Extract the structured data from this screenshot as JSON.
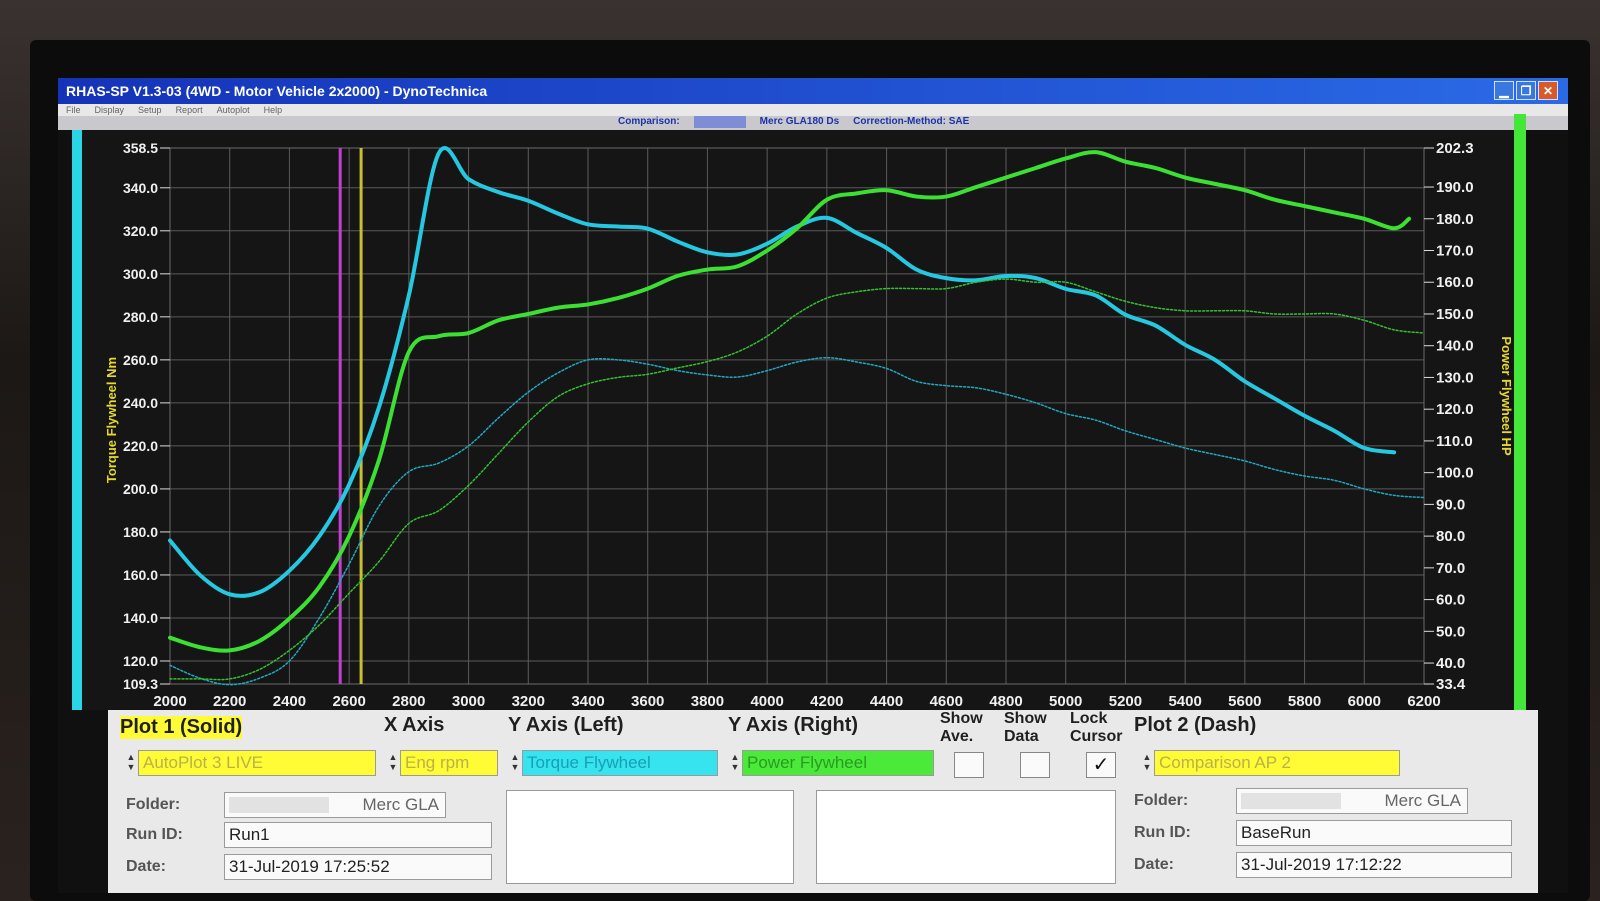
{
  "window": {
    "title": "RHAS-SP V1.3-03  (4WD - Motor Vehicle 2x2000) - DynoTechnica",
    "menu": [
      "File",
      "Display",
      "Setup",
      "Report",
      "Autoplot",
      "Help"
    ],
    "info_comparison": "Comparison:",
    "info_run": "Merc GLA180 Ds",
    "info_correction": "Correction-Method: SAE"
  },
  "chart_data": {
    "type": "line",
    "xlim": [
      2000,
      6200
    ],
    "x_ticks": [
      "2000",
      "2200",
      "2400",
      "2600",
      "2800",
      "3000",
      "3200",
      "3400",
      "3600",
      "3800",
      "4000",
      "4200",
      "4400",
      "4600",
      "4800",
      "5000",
      "5200",
      "5400",
      "5600",
      "5800",
      "6000",
      "6200"
    ],
    "ylabel_left": "Torque Flywheel Nm",
    "ylim_left": [
      109.3,
      358.5
    ],
    "y_ticks_left": [
      "358.5",
      "340.0",
      "320.0",
      "300.0",
      "280.0",
      "260.0",
      "240.0",
      "220.0",
      "200.0",
      "180.0",
      "160.0",
      "140.0",
      "120.0",
      "109.3"
    ],
    "ylabel_right": "Power Flywheel HP",
    "ylim_right": [
      33.4,
      202.3
    ],
    "y_ticks_right": [
      "202.3",
      "190.0",
      "180.0",
      "170.0",
      "160.0",
      "150.0",
      "140.0",
      "130.0",
      "120.0",
      "110.0",
      "100.0",
      "90.0",
      "80.0",
      "70.0",
      "60.0",
      "50.0",
      "40.0",
      "33.4"
    ],
    "grid": true,
    "cursor_lines": [
      {
        "x": 2570,
        "color": "#c040d0"
      },
      {
        "x": 2640,
        "color": "#c8c030"
      }
    ],
    "series": [
      {
        "axis": "left",
        "style": "solid",
        "color": "#25c8e0",
        "x": [
          2000,
          2100,
          2200,
          2300,
          2400,
          2500,
          2600,
          2700,
          2800,
          2900,
          3000,
          3100,
          3200,
          3300,
          3400,
          3500,
          3600,
          3700,
          3800,
          3900,
          4000,
          4100,
          4200,
          4300,
          4400,
          4500,
          4600,
          4700,
          4800,
          4900,
          5000,
          5100,
          5200,
          5300,
          5400,
          5500,
          5600,
          5700,
          5800,
          5900,
          6000,
          6100
        ],
        "y": [
          176,
          160,
          151,
          152,
          162,
          178,
          202,
          238,
          290,
          356,
          344,
          338,
          334,
          328,
          323,
          322,
          321,
          315,
          310,
          309,
          314,
          322,
          326,
          319,
          312,
          302,
          298,
          297,
          299,
          298,
          293,
          290,
          281,
          276,
          267,
          260,
          250,
          242,
          234,
          227,
          219,
          217
        ]
      },
      {
        "axis": "right",
        "style": "solid",
        "color": "#3ce032",
        "x": [
          2000,
          2100,
          2200,
          2300,
          2400,
          2500,
          2600,
          2700,
          2800,
          2900,
          3000,
          3100,
          3200,
          3300,
          3400,
          3500,
          3600,
          3700,
          3800,
          3900,
          4000,
          4100,
          4200,
          4300,
          4400,
          4500,
          4600,
          4700,
          4800,
          4900,
          5000,
          5100,
          5200,
          5300,
          5400,
          5500,
          5600,
          5700,
          5800,
          5900,
          6000,
          6100,
          6150
        ],
        "y": [
          48,
          45,
          44,
          47,
          54,
          64,
          80,
          104,
          138,
          143,
          144,
          148,
          150,
          152,
          153,
          155,
          158,
          162,
          164,
          165,
          170,
          177,
          186,
          188,
          189,
          187,
          187,
          190,
          193,
          196,
          199,
          201,
          198,
          196,
          193,
          191,
          189,
          186,
          184,
          182,
          180,
          177,
          180
        ]
      },
      {
        "axis": "left",
        "style": "dashed",
        "color": "#20a8c0",
        "x": [
          2000,
          2100,
          2200,
          2300,
          2400,
          2500,
          2600,
          2700,
          2800,
          2900,
          3000,
          3100,
          3200,
          3300,
          3400,
          3500,
          3600,
          3700,
          3800,
          3900,
          4000,
          4100,
          4200,
          4300,
          4400,
          4500,
          4600,
          4700,
          4800,
          4900,
          5000,
          5100,
          5200,
          5300,
          5400,
          5500,
          5600,
          5700,
          5800,
          5900,
          6000,
          6100,
          6200
        ],
        "y": [
          118,
          112,
          109,
          112,
          120,
          140,
          165,
          192,
          208,
          212,
          220,
          233,
          245,
          254,
          260,
          260,
          258,
          255,
          253,
          252,
          255,
          259,
          261,
          259,
          256,
          250,
          248,
          247,
          244,
          240,
          235,
          232,
          227,
          223,
          219,
          216,
          213,
          209,
          206,
          204,
          200,
          197,
          196
        ]
      },
      {
        "axis": "right",
        "style": "dashed",
        "color": "#34c030",
        "x": [
          2000,
          2100,
          2200,
          2300,
          2400,
          2500,
          2600,
          2700,
          2800,
          2900,
          3000,
          3100,
          3200,
          3300,
          3400,
          3500,
          3600,
          3700,
          3800,
          3900,
          4000,
          4100,
          4200,
          4300,
          4400,
          4500,
          4600,
          4700,
          4800,
          4900,
          5000,
          5100,
          5200,
          5300,
          5400,
          5500,
          5600,
          5700,
          5800,
          5900,
          6000,
          6100,
          6200
        ],
        "y": [
          35,
          35,
          35,
          38,
          44,
          52,
          62,
          72,
          84,
          88,
          96,
          106,
          116,
          124,
          128,
          130,
          131,
          133,
          135,
          138,
          143,
          150,
          155,
          157,
          158,
          158,
          158,
          160,
          161,
          160,
          160,
          157,
          154,
          152,
          151,
          151,
          151,
          150,
          150,
          150,
          148,
          145,
          144
        ]
      }
    ]
  },
  "panel": {
    "plot1_title": "Plot 1 (Solid)",
    "xaxis_title": "X Axis",
    "yleft_title": "Y Axis (Left)",
    "yright_title": "Y Axis (Right)",
    "show_ave_line1": "Show",
    "show_ave_line2": "Ave.",
    "show_data_line1": "Show",
    "show_data_line2": "Data",
    "lock_cursor_line1": "Lock",
    "lock_cursor_line2": "Cursor",
    "plot2_title": "Plot 2 (Dash)",
    "plot1_select": "AutoPlot 3 LIVE",
    "xaxis_select": "Eng rpm",
    "yleft_select": "Torque Flywheel",
    "yright_select": "Power Flywheel",
    "lock_cursor_checked": "✓",
    "plot2_select": "Comparison AP 2",
    "folder_label": "Folder:",
    "runid_label": "Run ID:",
    "date_label": "Date:",
    "plot1_folder": "Merc GLA",
    "plot1_runid": "Run1",
    "plot1_date": "31-Jul-2019  17:25:52",
    "plot2_folder": "Merc GLA",
    "plot2_runid": "BaseRun",
    "plot2_date": "31-Jul-2019  17:12:22"
  }
}
